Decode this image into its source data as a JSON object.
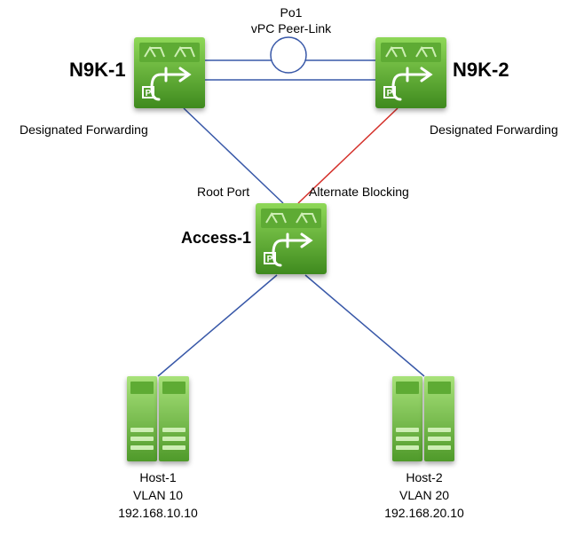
{
  "topology": {
    "po1": "Po1",
    "peer_link": "vPC Peer-Link",
    "n9k1": {
      "name": "N9K-1",
      "port_state": "Designated Forwarding"
    },
    "n9k2": {
      "name": "N9K-2",
      "port_state": "Designated Forwarding"
    },
    "access": {
      "name": "Access-1",
      "left_port_state": "Root Port",
      "right_port_state": "Alternate Blocking"
    },
    "host1": {
      "name": "Host-1",
      "vlan": "VLAN 10",
      "ip": "192.168.10.10"
    },
    "host2": {
      "name": "Host-2",
      "vlan": "VLAN 20",
      "ip": "192.168.20.10"
    }
  },
  "chart_data": {
    "type": "table",
    "title": "vPC network topology with STP port states",
    "nodes": [
      {
        "id": "N9K-1",
        "role": "nexus-switch",
        "stp_state_to_access": "Designated Forwarding"
      },
      {
        "id": "N9K-2",
        "role": "nexus-switch",
        "stp_state_to_access": "Designated Forwarding"
      },
      {
        "id": "Access-1",
        "role": "access-switch"
      },
      {
        "id": "Host-1",
        "role": "host",
        "vlan": 10,
        "ip": "192.168.10.10"
      },
      {
        "id": "Host-2",
        "role": "host",
        "vlan": 20,
        "ip": "192.168.20.10"
      }
    ],
    "links": [
      {
        "a": "N9K-1",
        "b": "N9K-2",
        "label": "Po1 vPC Peer-Link",
        "bundle": 2
      },
      {
        "a": "N9K-1",
        "b": "Access-1",
        "stp_state_at_access": "Root Port",
        "forwarding": true
      },
      {
        "a": "N9K-2",
        "b": "Access-1",
        "stp_state_at_access": "Alternate Blocking",
        "forwarding": false
      },
      {
        "a": "Access-1",
        "b": "Host-1"
      },
      {
        "a": "Access-1",
        "b": "Host-2"
      }
    ]
  }
}
